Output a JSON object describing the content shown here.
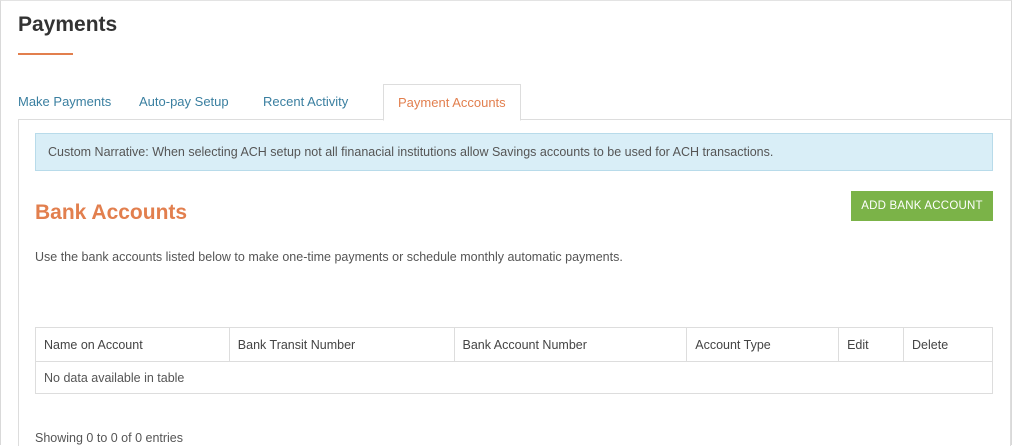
{
  "page": {
    "title": "Payments"
  },
  "tabs": [
    {
      "label": "Make Payments",
      "active": false
    },
    {
      "label": "Auto-pay Setup",
      "active": false
    },
    {
      "label": "Recent Activity",
      "active": false
    },
    {
      "label": "Payment Accounts",
      "active": true
    }
  ],
  "alert": {
    "text": "Custom Narrative: When selecting ACH setup not all finanacial institutions allow Savings accounts to be used for ACH transactions."
  },
  "bank_accounts": {
    "title": "Bank Accounts",
    "add_button_label": "ADD BANK ACCOUNT",
    "description": "Use the bank accounts listed below to make one-time payments or schedule monthly automatic payments.",
    "columns": [
      "Name on Account",
      "Bank Transit Number",
      "Bank Account Number",
      "Account Type",
      "Edit",
      "Delete"
    ],
    "empty_message": "No data available in table",
    "entries_info": "Showing 0 to 0 of 0 entries"
  },
  "colors": {
    "accent": "#e27f4e",
    "link": "#3a7fa0",
    "button": "#7bb348",
    "alert_bg": "#d9eef7"
  }
}
